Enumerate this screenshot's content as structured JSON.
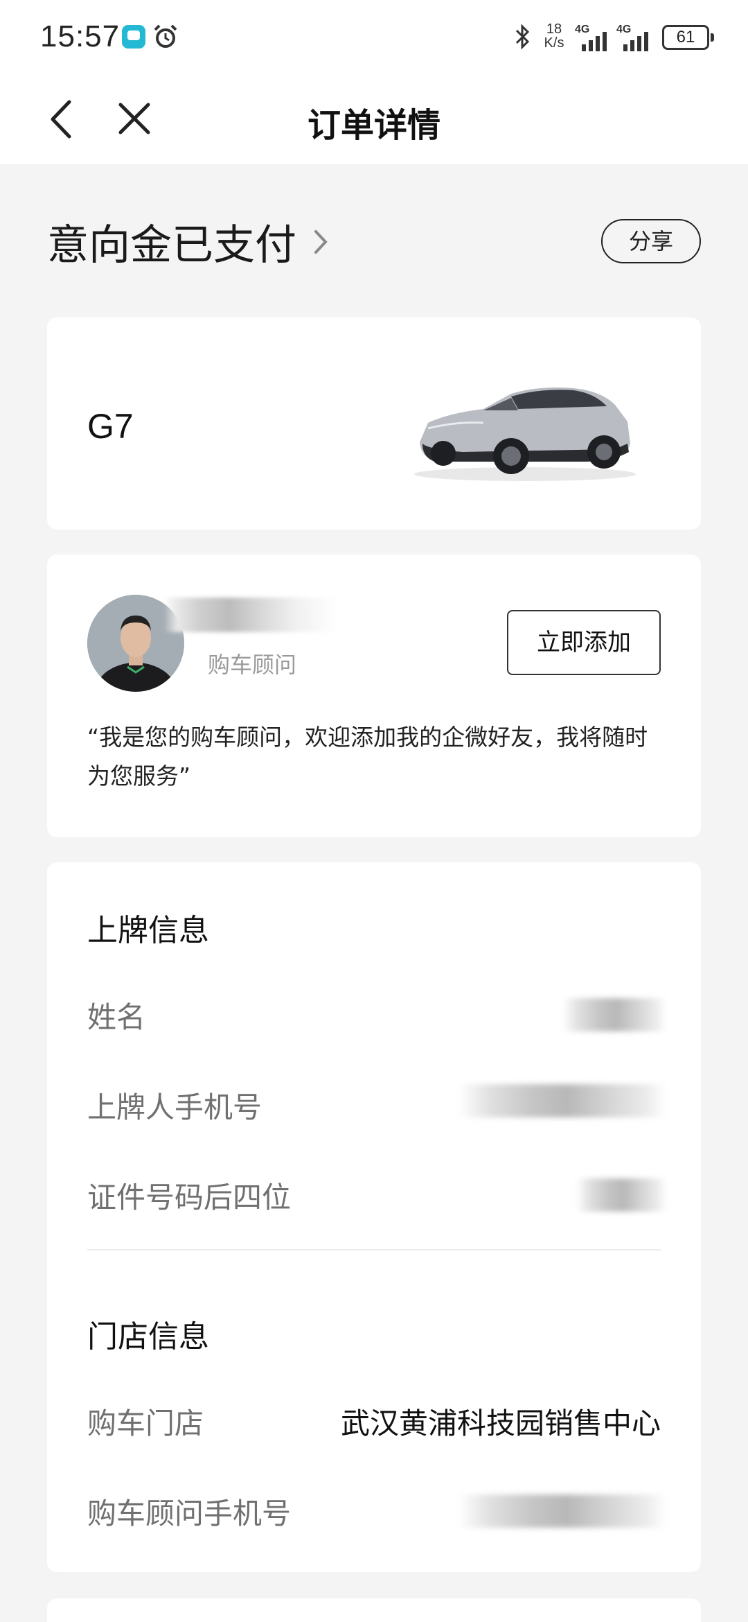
{
  "status_bar": {
    "time": "15:57",
    "net_speed_value": "18",
    "net_speed_unit": "K/s",
    "signal1_label": "4G",
    "signal2_label": "4G",
    "battery": "61"
  },
  "nav": {
    "title": "订单详情"
  },
  "order": {
    "status": "意向金已支付",
    "share_label": "分享"
  },
  "car": {
    "model": "G7"
  },
  "advisor": {
    "role": "购车顾问",
    "add_label": "立即添加",
    "quote": "“我是您的购车顾问，欢迎添加我的企微好友，我将随时为您服务”"
  },
  "registration": {
    "title": "上牌信息",
    "name_label": "姓名",
    "phone_label": "上牌人手机号",
    "id_label": "证件号码后四位"
  },
  "store": {
    "title": "门店信息",
    "store_label": "购车门店",
    "store_value": "武汉黄浦科技园销售中心",
    "advisor_phone_label": "购车顾问手机号"
  },
  "colors": {
    "background": "#f4f4f4",
    "card": "#ffffff",
    "label_gray": "#707070",
    "text_dark": "#111111"
  }
}
